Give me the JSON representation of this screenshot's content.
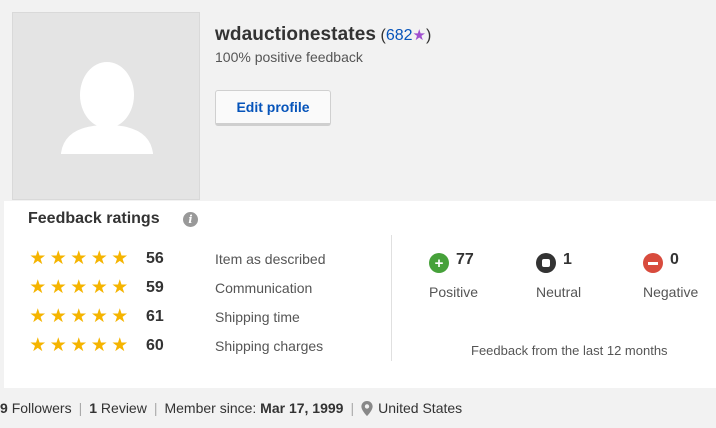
{
  "profile": {
    "username": "wdauctionestates",
    "feedback_score": "682",
    "star_icon": "star-icon",
    "star_color": "#a04fcf",
    "open_paren": "(",
    "close_paren": ")",
    "positive_feedback": "100% positive feedback",
    "edit_button": "Edit profile"
  },
  "ratings": {
    "title": "Feedback ratings",
    "info_icon": "info-icon",
    "items": [
      {
        "count": "56",
        "label": "Item as described",
        "stars": 5
      },
      {
        "count": "59",
        "label": "Communication",
        "stars": 5
      },
      {
        "count": "61",
        "label": "Shipping time",
        "stars": 5
      },
      {
        "count": "60",
        "label": "Shipping charges",
        "stars": 5
      }
    ]
  },
  "feedback": {
    "positive": {
      "count": "77",
      "label": "Positive",
      "icon": "plus-circle-icon",
      "color": "#46a13a"
    },
    "neutral": {
      "count": "1",
      "label": "Neutral",
      "icon": "square-circle-icon",
      "color": "#333333"
    },
    "negative": {
      "count": "0",
      "label": "Negative",
      "icon": "minus-circle-icon",
      "color": "#d84b3d"
    },
    "footnote": "Feedback from the last 12 months"
  },
  "stats": {
    "followers_count": "9",
    "followers_label": "Followers",
    "reviews_count": "1",
    "reviews_label": "Review",
    "member_since_label": "Member since:",
    "member_since_date": "Mar 17, 1999",
    "location": "United States",
    "separator": "|"
  },
  "colors": {
    "link": "#0654ba",
    "star": "#f5b400"
  }
}
